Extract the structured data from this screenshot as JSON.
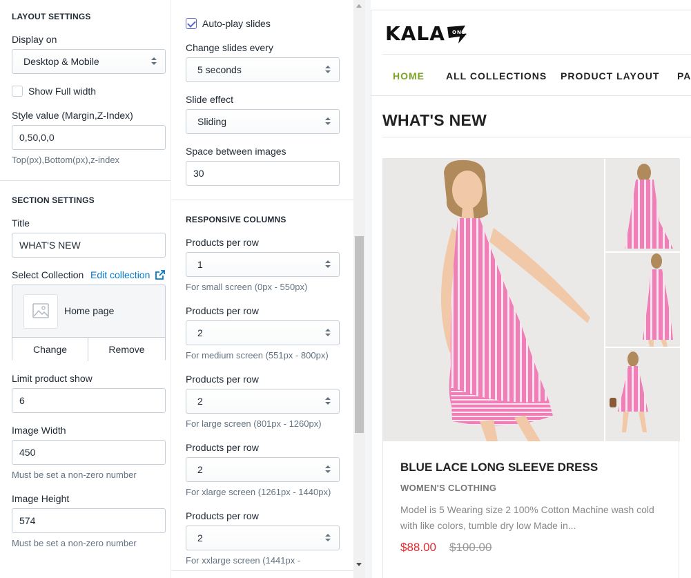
{
  "layout_settings": {
    "heading": "LAYOUT SETTINGS",
    "display_on_label": "Display on",
    "display_on_value": "Desktop & Mobile",
    "full_width_label": "Show Full width",
    "full_width_checked": false,
    "style_label": "Style value (Margin,Z-Index)",
    "style_value": "0,50,0,0",
    "style_help": "Top(px),Bottom(px),z-index"
  },
  "section_settings": {
    "heading": "SECTION SETTINGS",
    "title_label": "Title",
    "title_value": "WHAT'S NEW",
    "collection_label": "Select Collection",
    "edit_collection_link": "Edit collection",
    "collection_name": "Home page",
    "change_button": "Change",
    "remove_button": "Remove",
    "limit_label": "Limit product show",
    "limit_value": "6",
    "image_width_label": "Image Width",
    "image_width_value": "450",
    "image_width_help": "Must be set a non-zero number",
    "image_height_label": "Image Height",
    "image_height_value": "574",
    "image_height_help": "Must be set a non-zero number"
  },
  "slider": {
    "autoplay_label": "Auto-play slides",
    "autoplay_checked": true,
    "change_label": "Change slides every",
    "change_value": "5 seconds",
    "effect_label": "Slide effect",
    "effect_value": "Sliding",
    "space_label": "Space between images",
    "space_value": "30"
  },
  "responsive": {
    "heading": "RESPONSIVE COLUMNS",
    "rows": [
      {
        "label": "Products per row",
        "value": "1",
        "help": "For small screen (0px - 550px)"
      },
      {
        "label": "Products per row",
        "value": "2",
        "help": "For medium screen (551px - 800px)"
      },
      {
        "label": "Products per row",
        "value": "2",
        "help": "For large screen (801px - 1260px)"
      },
      {
        "label": "Products per row",
        "value": "2",
        "help": "For xlarge screen (1261px - 1440px)"
      },
      {
        "label": "Products per row",
        "value": "2",
        "help": "For xxlarge screen (1441px -"
      }
    ]
  },
  "preview": {
    "logo": "KALA",
    "nav": [
      "HOME",
      "ALL COLLECTIONS",
      "PRODUCT LAYOUT",
      "PA"
    ],
    "active_nav": "HOME",
    "section_title": "WHAT'S NEW",
    "product": {
      "name": "BLUE LACE LONG SLEEVE DRESS",
      "type": "WOMEN'S CLOTHING",
      "description": "Model is 5 Wearing size 2 100% Cotton Machine wash cold with like colors, tumble dry low Made in...",
      "price": "$88.00",
      "compare_price": "$100.00"
    }
  },
  "colors": {
    "accent_nav": "#7ca523",
    "price": "#e4262e",
    "checkbox": "#5c6ac4",
    "link": "#007ace",
    "dress": "#f07fb8"
  },
  "icons": {
    "caret": "chevron-up-down-icon",
    "external": "external-link-icon",
    "image_placeholder": "image-placeholder-icon"
  }
}
